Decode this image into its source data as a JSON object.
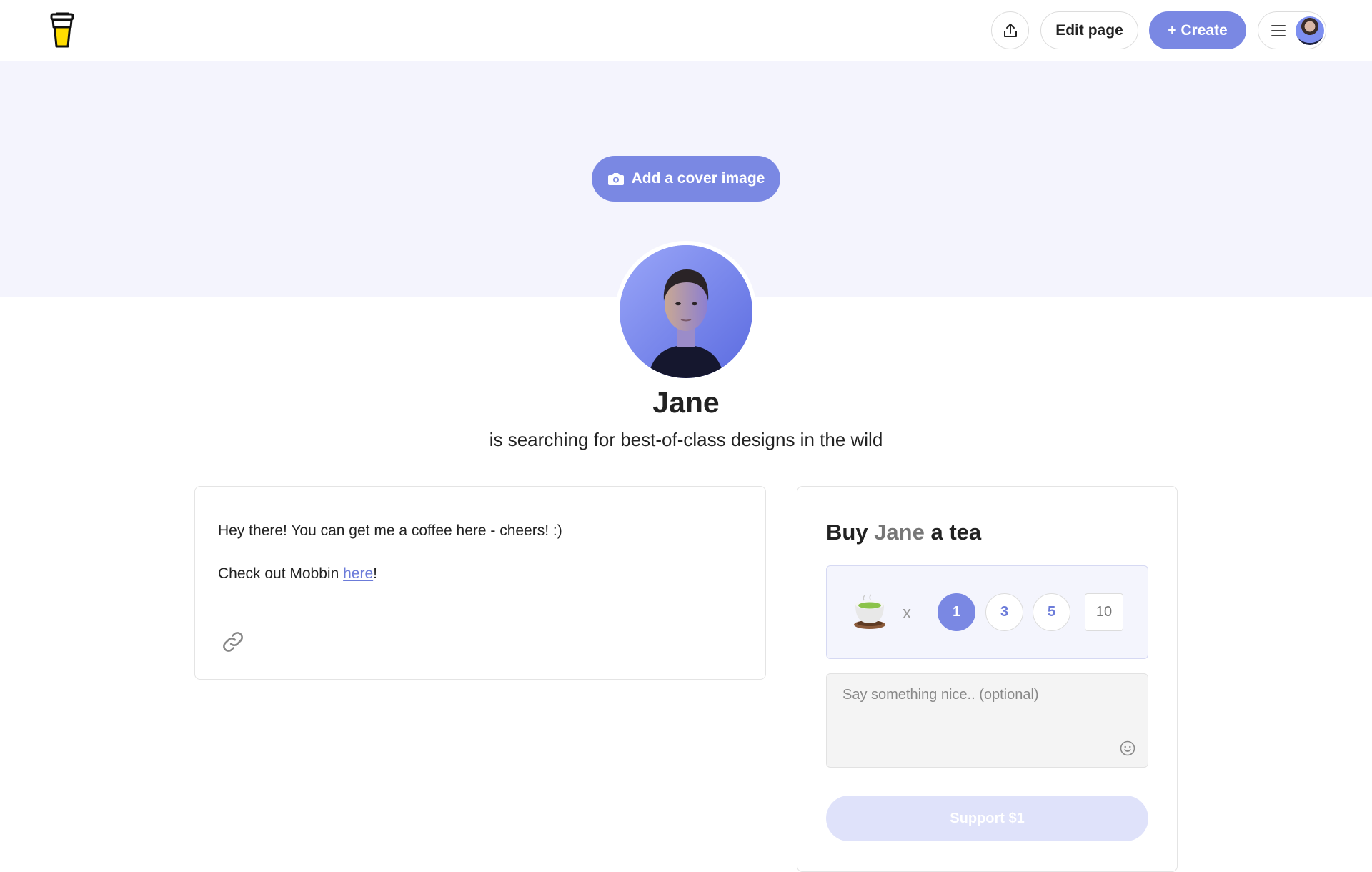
{
  "header": {
    "logo_icon": "coffee-cup-logo-icon",
    "share_icon": "share-upload-icon",
    "edit_label": "Edit page",
    "create_label": "+ Create",
    "menu_icon": "hamburger-menu-icon",
    "accent_color": "#7a88e3"
  },
  "cover": {
    "button_label": "Add a cover image",
    "button_icon": "camera-icon",
    "background_color": "#f4f4fd"
  },
  "profile": {
    "name": "Jane",
    "tagline": "is searching for best-of-class designs in the wild"
  },
  "about": {
    "line1": "Hey there! You can get me a coffee here - cheers! :)",
    "line2_prefix": "Check out Mobbin ",
    "line2_link": "here",
    "line2_suffix": "!",
    "link_icon": "link-icon"
  },
  "support": {
    "title_prefix": "Buy ",
    "title_name": "Jane",
    "title_suffix": " a tea",
    "item_icon": "tea-cup-icon",
    "multiplier": "x",
    "options": [
      "1",
      "3",
      "5"
    ],
    "selected_option": "1",
    "custom_value": "10",
    "message_placeholder": "Say something nice.. (optional)",
    "emoji_icon": "smiley-icon",
    "button_label": "Support $1"
  }
}
